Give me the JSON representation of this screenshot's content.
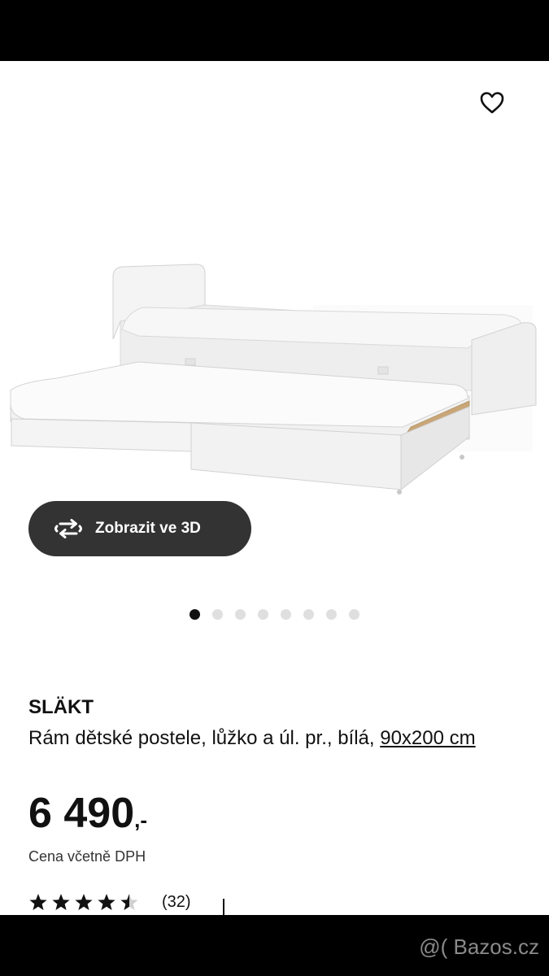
{
  "product": {
    "brand": "SLÄKT",
    "description": "Rám dětské postele, lůžko a úl. pr., bílá, ",
    "size_link": "90x200 cm",
    "price": "6 490",
    "price_suffix": ",-",
    "vat_note": "Cena včetně DPH",
    "rating": {
      "stars": 4.5,
      "max_stars": 5,
      "review_count": "(32)"
    }
  },
  "view3d": {
    "label": "Zobrazit ve 3D",
    "icon": "rotate-3d-icon"
  },
  "favorite": {
    "icon": "heart-outline-icon"
  },
  "carousel": {
    "total": 8,
    "active_index": 0
  },
  "watermark": "@( Bazos.cz"
}
